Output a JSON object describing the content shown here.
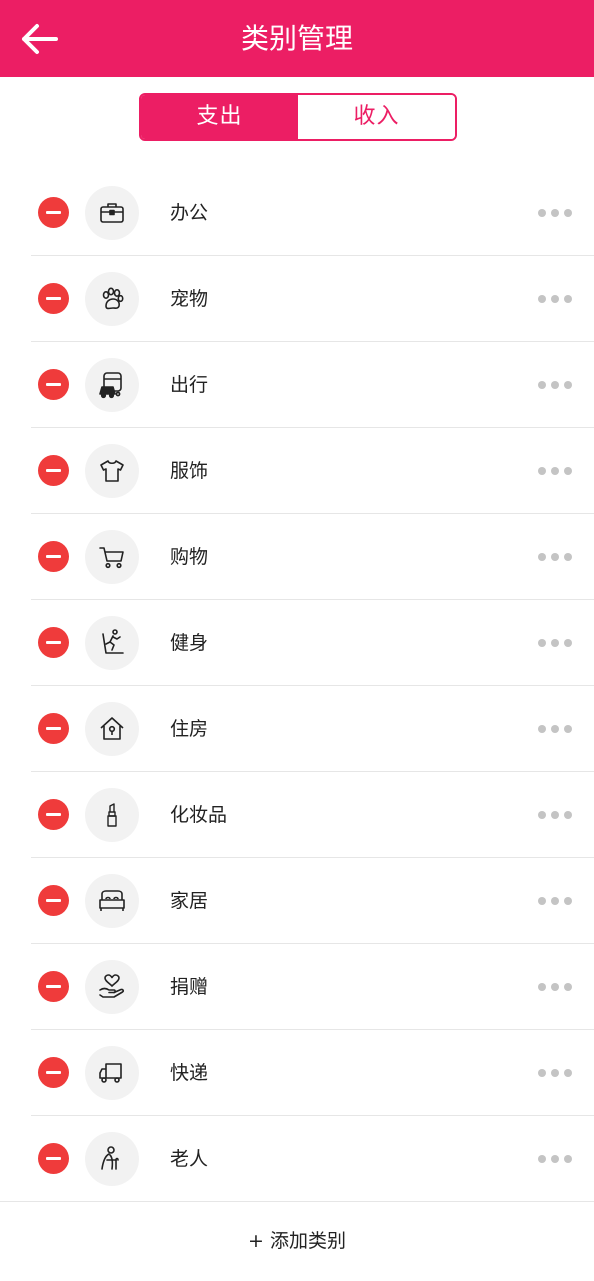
{
  "header": {
    "title": "类别管理",
    "back_icon": "arrow-left-icon"
  },
  "tabs": [
    {
      "label": "支出",
      "active": true
    },
    {
      "label": "收入",
      "active": false
    }
  ],
  "colors": {
    "accent": "#EC1E64",
    "delete": "#EF3B3B",
    "more_dots": "#C4C4C4",
    "icon_bg": "#F2F2F2"
  },
  "categories": [
    {
      "label": "办公",
      "icon": "briefcase-icon"
    },
    {
      "label": "宠物",
      "icon": "paw-icon"
    },
    {
      "label": "出行",
      "icon": "bus-car-icon"
    },
    {
      "label": "服饰",
      "icon": "tshirt-icon"
    },
    {
      "label": "购物",
      "icon": "shopping-cart-icon"
    },
    {
      "label": "健身",
      "icon": "treadmill-icon"
    },
    {
      "label": "住房",
      "icon": "house-icon"
    },
    {
      "label": "化妆品",
      "icon": "lipstick-icon"
    },
    {
      "label": "家居",
      "icon": "bed-icon"
    },
    {
      "label": "捐赠",
      "icon": "heart-hand-icon"
    },
    {
      "label": "快递",
      "icon": "delivery-truck-icon"
    },
    {
      "label": "老人",
      "icon": "elderly-icon"
    }
  ],
  "footer": {
    "add_label": "+ 添加类别"
  }
}
